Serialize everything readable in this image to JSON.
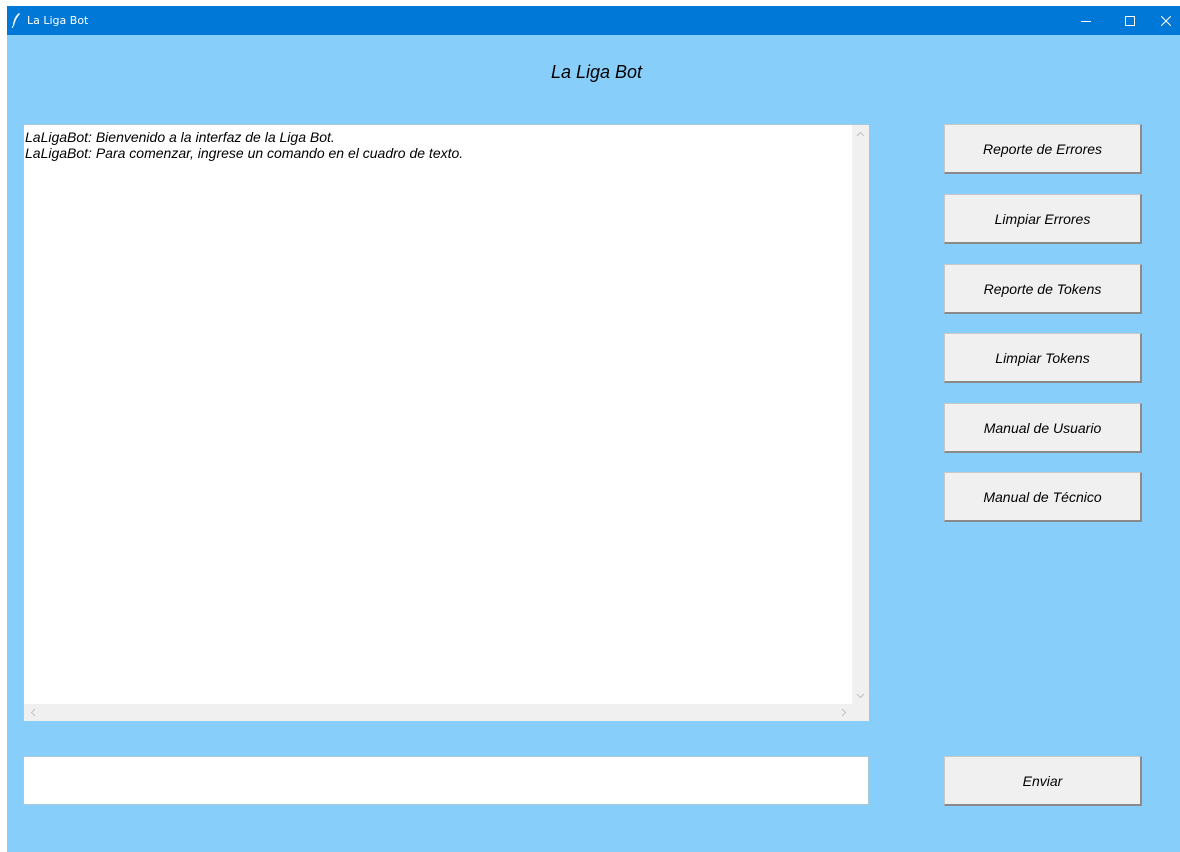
{
  "window": {
    "title": "La Liga Bot",
    "controls": {
      "minimize": "minimize-icon",
      "maximize": "maximize-icon",
      "close": "close-icon"
    },
    "titlebar_color": "#0078d7",
    "background_color": "#87cefa"
  },
  "header": {
    "title": "La Liga Bot"
  },
  "chat": {
    "messages": [
      "LaLigaBot: Bienvenido a la interfaz de la Liga Bot.",
      "LaLigaBot: Para comenzar, ingrese un comando en el cuadro de texto."
    ]
  },
  "sidebar": {
    "buttons": [
      {
        "label": "Reporte de Errores"
      },
      {
        "label": "Limpiar Errores"
      },
      {
        "label": "Reporte de Tokens"
      },
      {
        "label": "Limpiar Tokens"
      },
      {
        "label": "Manual de Usuario"
      },
      {
        "label": "Manual de Técnico"
      }
    ]
  },
  "input": {
    "value": "",
    "send_label": "Enviar"
  }
}
